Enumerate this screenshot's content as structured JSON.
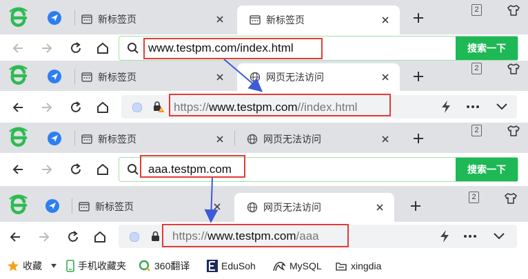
{
  "tabs": {
    "new_tab": "新标签页",
    "unreachable": "网页无法访问"
  },
  "tab_counter": "2",
  "panel1": {
    "typed": "www.testpm.com/index.html",
    "typed_bold": "www.testpm.com",
    "typed_rest": "/index.html"
  },
  "panel2": {
    "url_scheme": "https://",
    "url_host": "www.testpm.com",
    "url_path": "//index.html"
  },
  "panel3": {
    "typed": "aaa.testpm.com"
  },
  "panel4": {
    "url_scheme": "https://",
    "url_host": "www.testpm.com",
    "url_path": "/aaa"
  },
  "search_button": "搜索一下",
  "bookmarks": [
    {
      "label": "收藏",
      "icon": "star-icon"
    },
    {
      "label": "手机收藏夹",
      "icon": "phone-icon"
    },
    {
      "label": "360翻译",
      "icon": "translate-icon"
    },
    {
      "label": "EduSoh",
      "icon": "edusoho-icon"
    },
    {
      "label": "MySQL",
      "icon": "mysql-icon"
    },
    {
      "label": "xingdia",
      "icon": "folder-icon"
    }
  ],
  "colors": {
    "accent_green": "#1fb856",
    "highlight_red": "#e23b36",
    "arrow_blue": "#3c5bd6",
    "tabstrip": "#dfe1e5"
  }
}
